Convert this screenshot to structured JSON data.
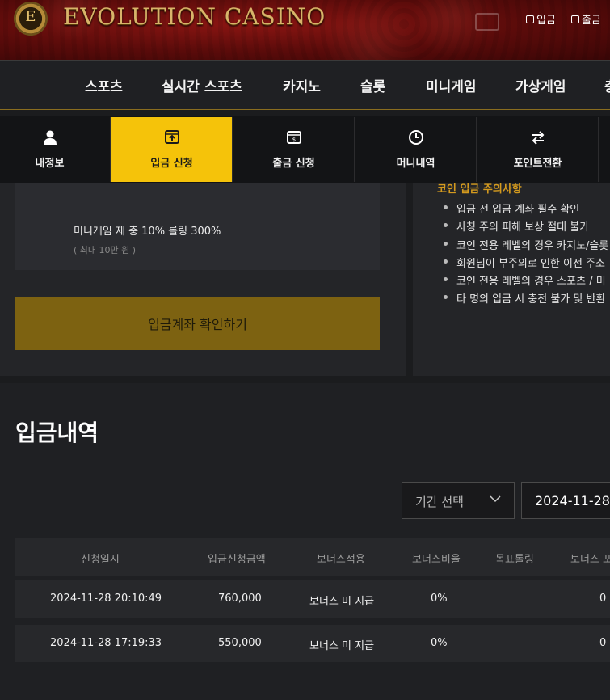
{
  "header": {
    "logo_letter": "E",
    "brand": "EVOLUTION CASINO",
    "links": [
      "입금",
      "출금"
    ]
  },
  "nav": {
    "items": [
      "스포츠",
      "실시간 스포츠",
      "카지노",
      "슬롯",
      "미니게임",
      "가상게임",
      "충"
    ]
  },
  "subnav": {
    "tabs": [
      {
        "label": "내정보",
        "icon": "user-icon"
      },
      {
        "label": "입금 신청",
        "icon": "deposit-icon",
        "active": true
      },
      {
        "label": "출금 신청",
        "icon": "withdraw-icon"
      },
      {
        "label": "머니내역",
        "icon": "clock-icon"
      },
      {
        "label": "포인트전환",
        "icon": "exchange-icon"
      }
    ]
  },
  "promo": {
    "title": "미니게임 재 충 10% 롤링 300%",
    "sub": "( 최대 10만 원 )"
  },
  "confirm_button": "입금계좌 확인하기",
  "notice": {
    "title": "코인 입금 주의사항",
    "items": [
      "입금 전 입금 계좌 필수 확인",
      "사칭 주의 피해 보상 절대 불가",
      "코인 전용 레벨의 경우 카지노/슬롯",
      "회원님이 부주의로 인한 이전 주소",
      "코인 전용 레벨의 경우 스포츠 / 미",
      "타 명의 입금 시 충전 불가 및 반환"
    ]
  },
  "history": {
    "title": "입금내역",
    "period_label": "기간 선택",
    "date_value": "2024-11-28",
    "columns": [
      "신청일시",
      "입금신청금액",
      "보너스적용",
      "보너스비율",
      "목표롤링",
      "보너스 포"
    ],
    "rows": [
      [
        "2024-11-28 20:10:49",
        "760,000",
        "보너스 미 지급",
        "0%",
        "",
        "0"
      ],
      [
        "2024-11-28 17:19:33",
        "550,000",
        "보너스 미 지급",
        "0%",
        "",
        "0"
      ]
    ]
  },
  "colors": {
    "accent": "#f5c30a",
    "button": "#7d6211",
    "notice_title": "#d49a1e"
  }
}
